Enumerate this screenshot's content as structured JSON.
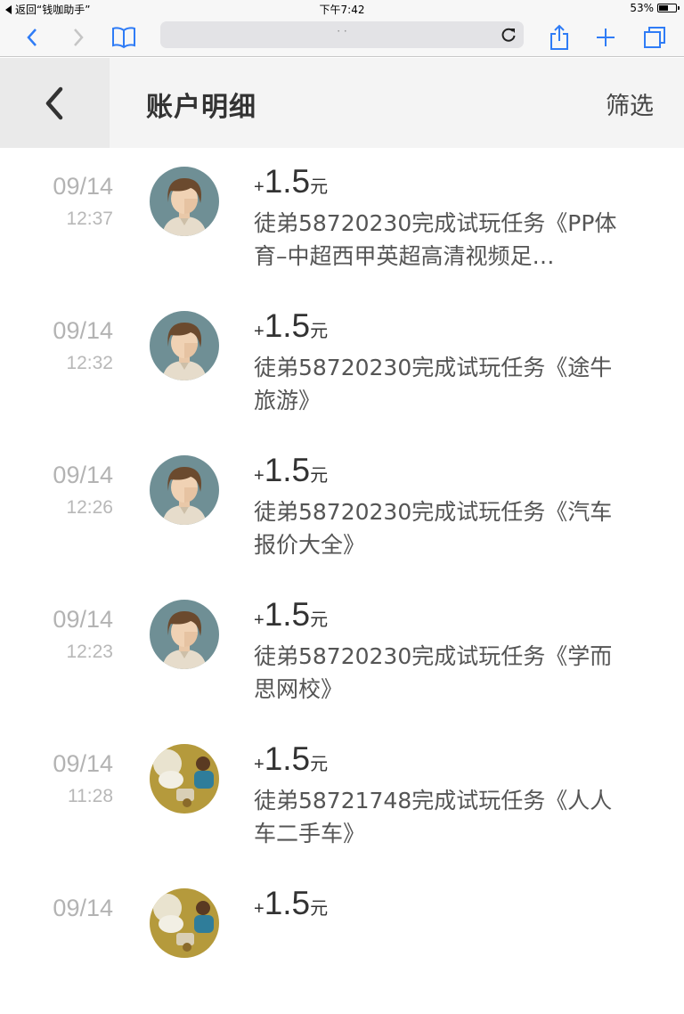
{
  "status_bar": {
    "back_label": "返回“钱咖助手”",
    "time": "下午7:42",
    "battery_text": "53%",
    "battery_level": 0.53
  },
  "browser": {
    "url_text": "· ·"
  },
  "header": {
    "title": "账户明细",
    "filter_label": "筛选"
  },
  "records": [
    {
      "date": "09/14",
      "time": "12:37",
      "sign": "+",
      "amount": "1.5",
      "unit": "元",
      "desc": "徒弟58720230完成试玩任务《PP体育–中超西甲英超高清视频足…",
      "avatar": "boy"
    },
    {
      "date": "09/14",
      "time": "12:32",
      "sign": "+",
      "amount": "1.5",
      "unit": "元",
      "desc": "徒弟58720230完成试玩任务《途牛旅游》",
      "avatar": "boy"
    },
    {
      "date": "09/14",
      "time": "12:26",
      "sign": "+",
      "amount": "1.5",
      "unit": "元",
      "desc": "徒弟58720230完成试玩任务《汽车报价大全》",
      "avatar": "boy"
    },
    {
      "date": "09/14",
      "time": "12:23",
      "sign": "+",
      "amount": "1.5",
      "unit": "元",
      "desc": "徒弟58720230完成试玩任务《学而思网校》",
      "avatar": "boy"
    },
    {
      "date": "09/14",
      "time": "11:28",
      "sign": "+",
      "amount": "1.5",
      "unit": "元",
      "desc": "徒弟58721748完成试玩任务《人人车二手车》",
      "avatar": "photo"
    },
    {
      "date": "09/14",
      "time": "",
      "sign": "+",
      "amount": "1.5",
      "unit": "元",
      "desc": "",
      "avatar": "photo"
    }
  ],
  "colors": {
    "ios_blue": "#2f7cf6",
    "avatar_bg": "#6f8f95"
  }
}
